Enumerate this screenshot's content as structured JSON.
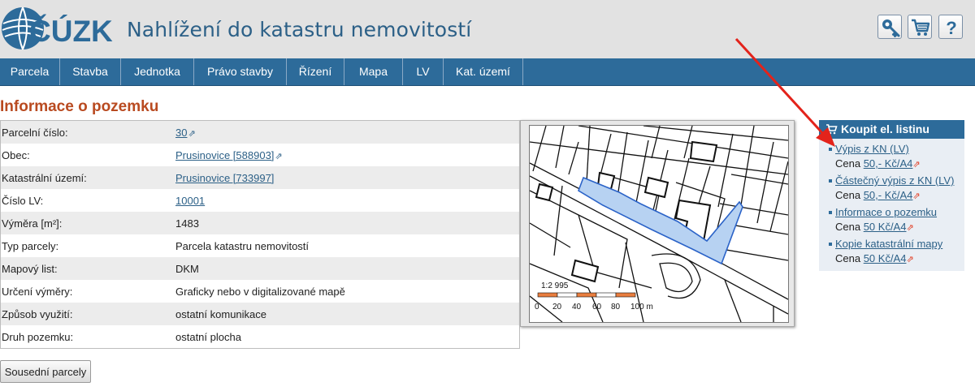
{
  "header": {
    "logo_text": "ČÚZK",
    "title": "Nahlížení do katastru nemovitostí",
    "buttons": [
      {
        "name": "search-key-button",
        "icon": "key-icon"
      },
      {
        "name": "cart-button",
        "icon": "cart-icon"
      },
      {
        "name": "help-button",
        "icon": "help-icon",
        "label": "?"
      }
    ]
  },
  "nav": {
    "items": [
      "Parcela",
      "Stavba",
      "Jednotka",
      "Právo stavby",
      "Řízení",
      "Mapa",
      "LV",
      "Kat. území"
    ]
  },
  "page": {
    "title": "Informace o pozemku"
  },
  "parcel": {
    "rows": [
      {
        "label": "Parcelní číslo:",
        "value": "30",
        "link": true,
        "ext": true
      },
      {
        "label": "Obec:",
        "value": "Prusinovice [588903]",
        "link": true,
        "ext": true
      },
      {
        "label": "Katastrální území:",
        "value": "Prusinovice [733997]",
        "link": true,
        "ext": false
      },
      {
        "label": "Číslo LV:",
        "value": "10001",
        "link": true,
        "ext": false
      },
      {
        "label": "Výměra [m²]:",
        "value": "1483",
        "link": false,
        "ext": false
      },
      {
        "label": "Typ parcely:",
        "value": "Parcela katastru nemovitostí",
        "link": false,
        "ext": false
      },
      {
        "label": "Mapový list:",
        "value": "DKM",
        "link": false,
        "ext": false
      },
      {
        "label": "Určení výměry:",
        "value": "Graficky nebo v digitalizované mapě",
        "link": false,
        "ext": false
      },
      {
        "label": "Způsob využití:",
        "value": "ostatní komunikace",
        "link": false,
        "ext": false
      },
      {
        "label": "Druh pozemku:",
        "value": "ostatní plocha",
        "link": false,
        "ext": false
      }
    ],
    "neighbors_button": "Sousední parcely"
  },
  "map": {
    "scale_text": "1:2 995",
    "scale_ticks": [
      "0",
      "20",
      "40",
      "60",
      "80",
      "100 m"
    ],
    "parcel_color": "#b7d2f2",
    "parcel_stroke": "#2b63c8"
  },
  "buy": {
    "title": "Koupit el. listinu",
    "price_label": "Cena",
    "items": [
      {
        "label": "Výpis z KN (LV)",
        "price": "50,- Kč/A4"
      },
      {
        "label": "Částečný výpis z KN (LV)",
        "price": "50,- Kč/A4"
      },
      {
        "label": "Informace o pozemku",
        "price": "50 Kč/A4"
      },
      {
        "label": "Kopie katastrální mapy",
        "price": "50 Kč/A4"
      }
    ]
  },
  "colors": {
    "nav": "#2d6b9a",
    "title_accent": "#b94a20",
    "link": "#2c6087",
    "arrow": "#e3231b"
  }
}
